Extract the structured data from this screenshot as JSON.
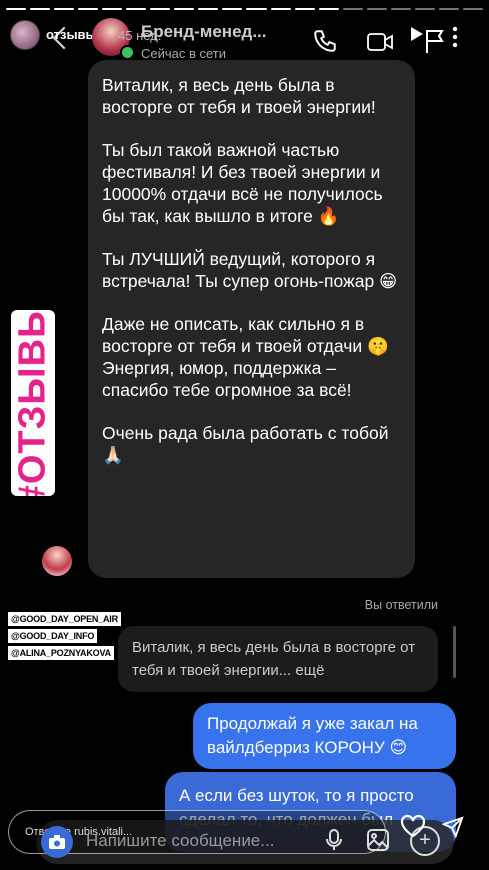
{
  "story": {
    "account": "отзывы",
    "time": "45 нед."
  },
  "header": {
    "name": "Бренд-менед...",
    "status": "Сейчас в сети"
  },
  "sticker": {
    "hashtag": "#ОТЗЫВЫ"
  },
  "messages": {
    "incoming": [
      "Виталик, я весь день была в восторге от тебя и твоей энергии!",
      "Ты был такой важной частью фестиваля! И без твоей энергии и 10000% отдачи всё не получилось бы так, как вышло в итоге 🔥",
      "Ты ЛУЧШИЙ ведущий, которого я встречала! Ты супер огонь-пожар 😁",
      "Даже не описать, как сильно я в восторге от тебя и твоей отдачи 🤫",
      "Энергия, юмор, поддержка – спасибо тебе огромное за всё!",
      "Очень рада была работать с тобой 🙏🏻"
    ],
    "replied_label": "Вы ответили",
    "quoted": "Виталик, я весь день была в восторге от тебя и твоей энергии... ещё",
    "outgoing": [
      "Продолжай я уже закал на вайлдберриз КОРОНУ 😊",
      "А если без шуток, то я просто сделал то, что должен был"
    ]
  },
  "mentions": [
    "@GOOD_DAY_OPEN_AIR",
    "@GOOD_DAY_INFO",
    "@ALINA_POZNYAKOVA"
  ],
  "footer": {
    "story_reply_placeholder": "Ответьте rubis.vitali...",
    "compose_placeholder": "Напишите сообщение..."
  },
  "icons": {
    "phone": "phone-icon",
    "video": "video-icon",
    "camera": "camera-icon",
    "mic": "mic-icon",
    "gallery": "gallery-icon",
    "heart": "heart-icon",
    "send": "send-icon"
  },
  "colors": {
    "bubble_incoming": "#262626",
    "bubble_outgoing": "#3673ec",
    "hashtag": "#e6238a",
    "online": "#3ac25b"
  }
}
